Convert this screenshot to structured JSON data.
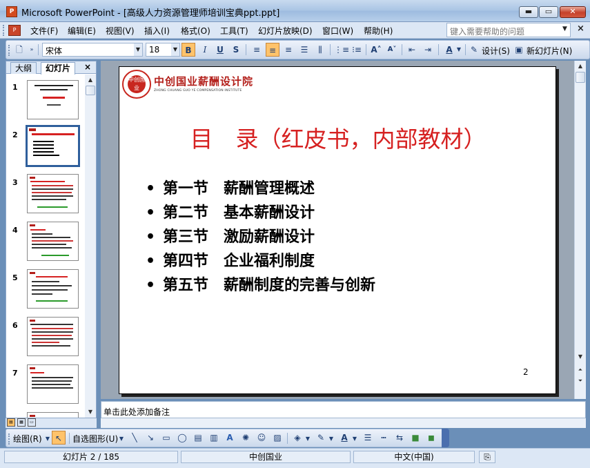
{
  "window": {
    "title": "Microsoft PowerPoint - [高级人力资源管理师培训宝典ppt.ppt]",
    "app_icon_text": "P",
    "min_label": "▬",
    "max_label": "▭",
    "close_label": "✕"
  },
  "menu": {
    "items": [
      "文件(F)",
      "编辑(E)",
      "视图(V)",
      "插入(I)",
      "格式(O)",
      "工具(T)",
      "幻灯片放映(D)",
      "窗口(W)",
      "帮助(H)"
    ],
    "help_placeholder": "键入需要帮助的问题",
    "close_doc": "×"
  },
  "toolbar": {
    "font_name": "宋体",
    "font_size": "18",
    "bold": "B",
    "italic": "I",
    "underline": "U",
    "shadow": "S",
    "design_label": "设计(S)",
    "new_slide_label": "新幻灯片(N)"
  },
  "left_pane": {
    "tab_outline": "大纲",
    "tab_slides": "幻灯片",
    "close": "×",
    "slides": [
      "1",
      "2",
      "3",
      "4",
      "5",
      "6",
      "7"
    ],
    "selected_slide": 2
  },
  "slide": {
    "logo_cn": "中创国业薪酬设计院",
    "logo_en": "ZHONG CHUANG GUO YE COMPENSATION INSTITUTE",
    "logo_seal": "中创国业",
    "title": "目　录（红皮书，内部教材）",
    "bullets": [
      "第一节　薪酬管理概述",
      "第二节　基本薪酬设计",
      "第三节　激励薪酬设计",
      "第四节　企业福利制度",
      "第五节　薪酬制度的完善与创新"
    ],
    "page_number": "2"
  },
  "notes": {
    "placeholder": "单击此处添加备注"
  },
  "draw_toolbar": {
    "draw_label": "绘图(R)",
    "autoshapes_label": "自选图形(U)"
  },
  "statusbar": {
    "slide_position": "幻灯片 2 / 185",
    "design_template": "中创国业",
    "language": "中文(中国)"
  },
  "colors": {
    "title_red": "#d62121",
    "logo_red": "#b31f1a",
    "selection_blue": "#2f5f9c"
  }
}
